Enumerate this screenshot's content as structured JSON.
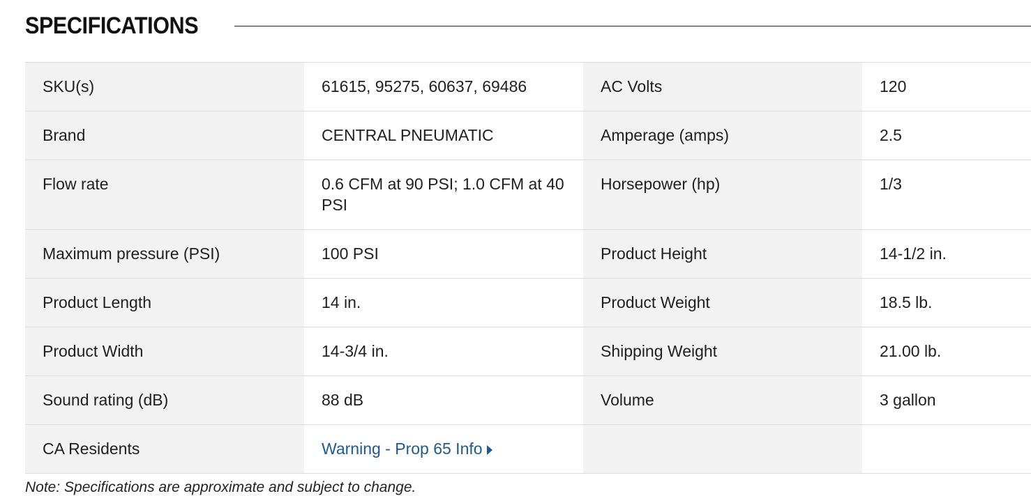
{
  "section": {
    "title": "SPECIFICATIONS"
  },
  "specs": {
    "rows": [
      {
        "l1": "SKU(s)",
        "v1": "61615, 95275, 60637, 69486",
        "l2": "AC Volts",
        "v2": "120"
      },
      {
        "l1": "Brand",
        "v1": "CENTRAL PNEUMATIC",
        "l2": "Amperage (amps)",
        "v2": "2.5"
      },
      {
        "l1": "Flow rate",
        "v1": "0.6 CFM at 90 PSI; 1.0 CFM at 40 PSI",
        "l2": "Horsepower (hp)",
        "v2": "1/3"
      },
      {
        "l1": "Maximum pressure (PSI)",
        "v1": "100 PSI",
        "l2": "Product Height",
        "v2": "14-1/2 in."
      },
      {
        "l1": "Product Length",
        "v1": "14 in.",
        "l2": "Product Weight",
        "v2": "18.5 lb."
      },
      {
        "l1": "Product Width",
        "v1": "14-3/4 in.",
        "l2": "Shipping Weight",
        "v2": "21.00 lb."
      },
      {
        "l1": "Sound rating (dB)",
        "v1": "88 dB",
        "l2": "Volume",
        "v2": "3 gallon"
      },
      {
        "l1": "CA Residents",
        "v1_link": "Warning - Prop 65 Info",
        "l2": "",
        "v2": ""
      }
    ]
  },
  "note": "Note: Specifications are approximate and subject to change.",
  "colors": {
    "label_bg": "#f2f2f2",
    "link": "#1d5a94",
    "divider": "#dcdcdc"
  }
}
